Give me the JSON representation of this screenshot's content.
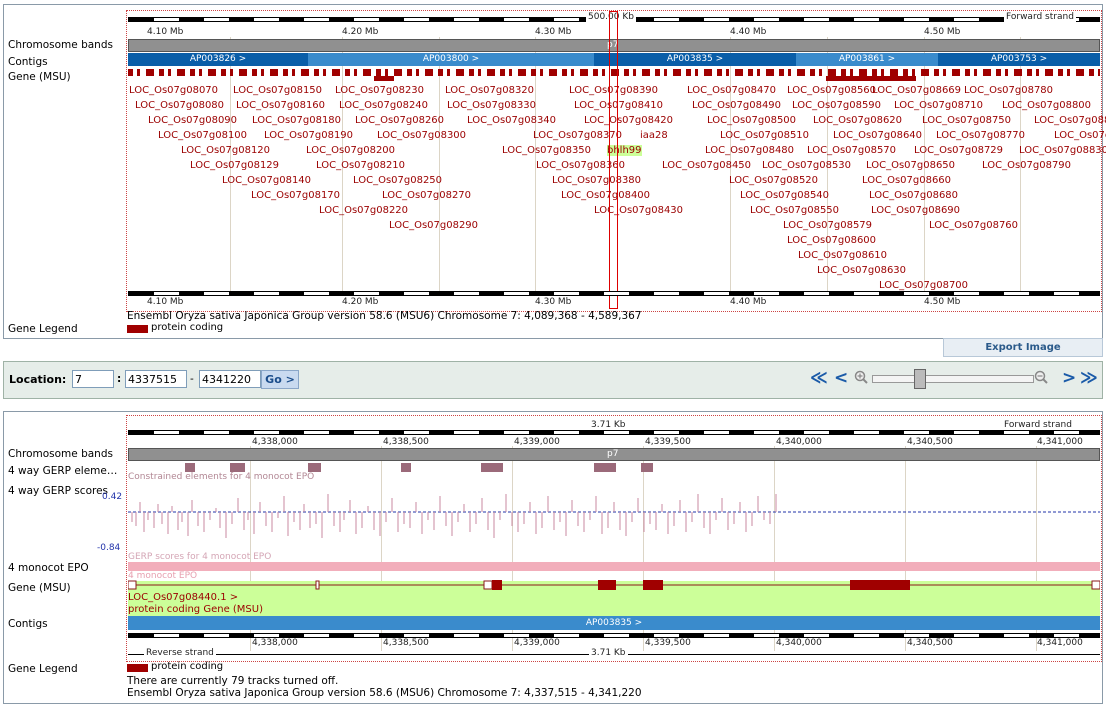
{
  "top": {
    "scale_label": "500.00 Kb",
    "strand_label": "Forward strand",
    "ticks": [
      "4.10 Mb",
      "4.20 Mb",
      "4.30 Mb",
      "4.40 Mb",
      "4.50 Mb"
    ],
    "track_labels": {
      "bands": "Chromosome bands",
      "contigs": "Contigs",
      "gene": "Gene (MSU)",
      "legend": "Gene Legend"
    },
    "band_label": "p7",
    "contigs": [
      "AP003826 >",
      "AP003800 >",
      "AP003835 >",
      "AP003861 >",
      "AP003753 >"
    ],
    "genes": [
      "LOC_Os07g08070",
      "LOC_Os07g08150",
      "LOC_Os07g08230",
      "LOC_Os07g08320",
      "LOC_Os07g08390",
      "LOC_Os07g08470",
      "LOC_Os07g08560",
      "LOC_Os07g08669",
      "LOC_Os07g08780",
      "LOC_Os07g08080",
      "LOC_Os07g08160",
      "LOC_Os07g08240",
      "LOC_Os07g08330",
      "LOC_Os07g08410",
      "LOC_Os07g08490",
      "LOC_Os07g08590",
      "LOC_Os07g08710",
      "LOC_Os07g08800",
      "LOC_Os07g08090",
      "LOC_Os07g08180",
      "LOC_Os07g08260",
      "LOC_Os07g08340",
      "LOC_Os07g08420",
      "LOC_Os07g08500",
      "LOC_Os07g08620",
      "LOC_Os07g08750",
      "LOC_Os07g08810",
      "LOC_Os07g08100",
      "LOC_Os07g08190",
      "LOC_Os07g08300",
      "LOC_Os07g08370",
      "iaa28",
      "LOC_Os07g08510",
      "LOC_Os07g08640",
      "LOC_Os07g08770",
      "LOC_Os07g08820",
      "LOC_Os07g08120",
      "LOC_Os07g08200",
      "LOC_Os07g08350",
      "bhlh99",
      "LOC_Os07g08480",
      "LOC_Os07g08570",
      "LOC_Os07g08729",
      "LOC_Os07g08830",
      "LOC_Os07g08129",
      "LOC_Os07g08210",
      "LOC_Os07g08360",
      "LOC_Os07g08450",
      "LOC_Os07g08530",
      "LOC_Os07g08650",
      "LOC_Os07g08790",
      "LOC_Os07g08140",
      "LOC_Os07g08250",
      "LOC_Os07g08380",
      "LOC_Os07g08520",
      "LOC_Os07g08660",
      "LOC_Os07g08170",
      "LOC_Os07g08270",
      "LOC_Os07g08400",
      "LOC_Os07g08540",
      "LOC_Os07g08680",
      "LOC_Os07g08220",
      "LOC_Os07g08430",
      "LOC_Os07g08550",
      "LOC_Os07g08690",
      "LOC_Os07g08290",
      "LOC_Os07g08579",
      "LOC_Os07g08760",
      "LOC_Os07g08600",
      "LOC_Os07g08610",
      "LOC_Os07g08630",
      "LOC_Os07g08700"
    ],
    "footer": "Ensembl Oryza sativa Japonica Group version 58.6 (MSU6) Chromosome 7: 4,089,368 - 4,589,367",
    "legend_item": "protein coding",
    "export_label": "Export Image"
  },
  "location": {
    "label": "Location:",
    "chrom": "7",
    "sep": ":",
    "start": "4337515",
    "dash": "-",
    "end": "4341220",
    "go": "Go >"
  },
  "nav": {
    "left_far": "≪",
    "left": "<",
    "right": ">",
    "right_far": "≫"
  },
  "bottom": {
    "scale_label": "3.71 Kb",
    "strand_label": "Forward strand",
    "reverse_label": "Reverse strand",
    "ticks": [
      "4,338,000",
      "4,338,500",
      "4,339,000",
      "4,339,500",
      "4,340,000",
      "4,340,500",
      "4,341,000"
    ],
    "track_labels": {
      "bands": "Chromosome bands",
      "gerp_elem": "4 way GERP eleme…",
      "gerp_scores": "4 way GERP scores",
      "epo": "4 monocot EPO",
      "gene": "Gene (MSU)",
      "contigs": "Contigs",
      "legend": "Gene Legend"
    },
    "band_label": "p7",
    "gerp_caption": "Constrained elements for 4 monocot EPO",
    "score_max": "0.42",
    "score_min": "-0.84",
    "scores_caption": "GERP scores for 4 monocot EPO",
    "epo_caption": "4 monocot EPO",
    "gene_name": "LOC_Os07g08440.1 >",
    "gene_type": "protein coding Gene (MSU)",
    "contig": "AP003835 >",
    "legend_item": "protein coding",
    "tracks_off": "There are currently 79 tracks turned off.",
    "footer": "Ensembl Oryza sativa Japonica Group version 58.6 (MSU6) Chromosome 7: 4,337,515 - 4,341,220"
  },
  "colors": {
    "gene": "#9b0000",
    "contig_dark": "#0a5ea8",
    "contig_light": "#3a8bcc",
    "band": "#909090",
    "gene_bg": "#ccff99",
    "epo": "#f2aebb"
  }
}
